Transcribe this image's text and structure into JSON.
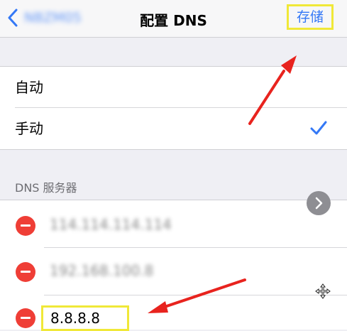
{
  "nav": {
    "back_label": "NBZM05",
    "title": "配置 DNS",
    "save_label": "存储"
  },
  "mode": {
    "options": [
      {
        "label": "自动",
        "selected": false
      },
      {
        "label": "手动",
        "selected": true
      }
    ]
  },
  "dns": {
    "header": "DNS 服务器",
    "servers": [
      "114.114.114.114",
      "192.168.100.8",
      "8.8.8.8"
    ]
  },
  "colors": {
    "accent": "#3478f6",
    "delete": "#ef3e36",
    "highlight": "#f0e838",
    "arrow": "#e8231e"
  },
  "icons": [
    "back-chevron-icon",
    "checkmark-icon",
    "minus-circle-icon",
    "chevron-right-icon",
    "move-cursor-icon",
    "arrow-annotation"
  ]
}
